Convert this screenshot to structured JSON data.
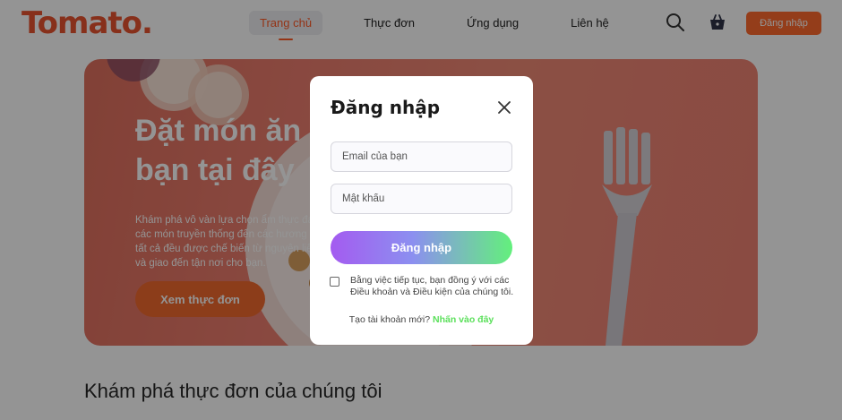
{
  "navbar": {
    "logo": "Tomato.",
    "menu": [
      "Trang chủ",
      "Thực đơn",
      "Ứng dụng",
      "Liên hệ"
    ],
    "login_label": "Đăng nhập"
  },
  "hero": {
    "title": "Đặt món ăn của bạn tại đây",
    "description": "Khám phá vô vàn lựa chọn ẩm thực đa dạng, từ các món truyền thống đến các hương vị hiện đại, tất cả đều được chế biến từ nguyên liệu tươi ngon và giao đến tận nơi cho bạn.",
    "button_label": "Xem thực đơn"
  },
  "section": {
    "title": "Khám phá thực đơn của chúng tôi"
  },
  "modal": {
    "title": "Đăng nhập",
    "email_placeholder": "Email của bạn",
    "password_placeholder": "Mật khẩu",
    "submit_label": "Đăng nhập",
    "terms_text": "Bằng việc tiếp tục, bạn đồng ý với các Điều khoản và Điều kiện của chúng tôi.",
    "signup_prompt": "Tạo tài khoản mới?",
    "signup_link": "Nhấn vào đây"
  },
  "colors": {
    "brand": "#e8542f",
    "accent_orange": "#ff6a2d",
    "link_green": "#5be05b",
    "gradient_start": "#a45bf0",
    "gradient_end": "#63f07c"
  },
  "icons": [
    "search-icon",
    "basket-icon",
    "close-icon"
  ]
}
